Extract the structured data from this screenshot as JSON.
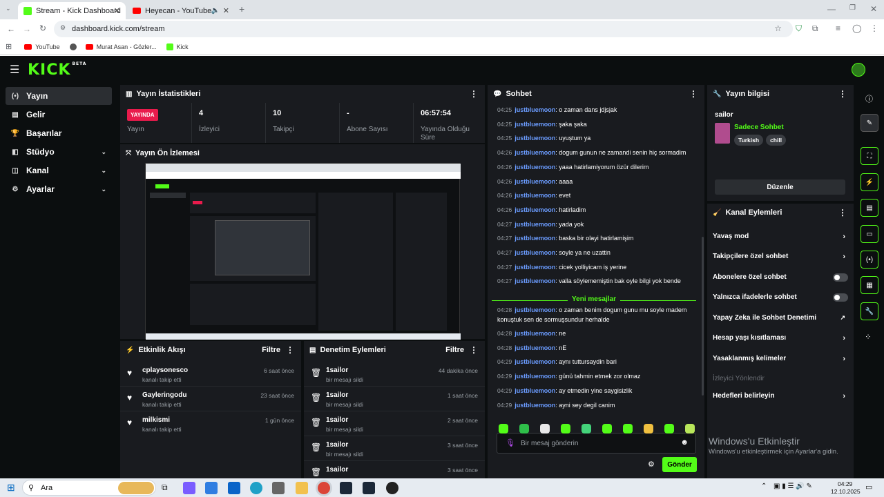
{
  "browser": {
    "tabs": [
      {
        "title": "Stream - Kick Dashboard",
        "active": true
      },
      {
        "title": "Heyecan - YouTube",
        "active": false
      }
    ],
    "url": "dashboard.kick.com/stream",
    "bookmarks": [
      "YouTube",
      "Murat Asan - Gözler...",
      "Kick"
    ]
  },
  "colors": {
    "accent": "#53fc18",
    "live": "#e91b4c",
    "username": "#6b9cff"
  },
  "logo": {
    "text": "KICK",
    "badge": "BETA"
  },
  "nav": [
    {
      "label": "Yayın",
      "icon": "stream-icon",
      "chevron": false,
      "active": true
    },
    {
      "label": "Gelir",
      "icon": "wallet-icon",
      "chevron": false
    },
    {
      "label": "Başarılar",
      "icon": "trophy-icon",
      "chevron": false
    },
    {
      "label": "Stüdyo",
      "icon": "studio-icon",
      "chevron": true
    },
    {
      "label": "Kanal",
      "icon": "channel-icon",
      "chevron": true
    },
    {
      "label": "Ayarlar",
      "icon": "gear-icon",
      "chevron": true
    }
  ],
  "stats": {
    "title": "Yayın İstatistikleri",
    "items": [
      {
        "value": "YAYINDA",
        "label": "Yayın"
      },
      {
        "value": "4",
        "label": "İzleyici"
      },
      {
        "value": "10",
        "label": "Takipçi"
      },
      {
        "value": "-",
        "label": "Abone Sayısı"
      },
      {
        "value": "06:57:54",
        "label": "Yayında Olduğu Süre"
      }
    ]
  },
  "preview": {
    "title": "Yayın Ön İzlemesi"
  },
  "activity": {
    "title": "Etkinlik Akışı",
    "filter": "Filtre",
    "items": [
      {
        "name": "cplaysonesco",
        "sub": "kanalı takip etti",
        "time": "6 saat önce"
      },
      {
        "name": "Gayleringodu",
        "sub": "kanalı takip etti",
        "time": "23 saat önce"
      },
      {
        "name": "milkismi",
        "sub": "kanalı takip etti",
        "time": "1 gün önce"
      }
    ]
  },
  "moderation": {
    "title": "Denetim Eylemleri",
    "filter": "Filtre",
    "items": [
      {
        "name": "1sailor",
        "sub": "bir mesajı sildi",
        "time": "44 dakika önce"
      },
      {
        "name": "1sailor",
        "sub": "bir mesajı sildi",
        "time": "1 saat önce"
      },
      {
        "name": "1sailor",
        "sub": "bir mesajı sildi",
        "time": "2 saat önce"
      },
      {
        "name": "1sailor",
        "sub": "bir mesajı sildi",
        "time": "3 saat önce"
      },
      {
        "name": "1sailor",
        "sub": "",
        "time": "3 saat önce"
      }
    ]
  },
  "chat": {
    "title": "Sohbet",
    "messages_top": [
      {
        "time": "04:25",
        "user": "justbluemoon",
        "text": ": o zaman dans jdjsjak"
      },
      {
        "time": "04:25",
        "user": "justbluemoon",
        "text": ": şaka şaka"
      },
      {
        "time": "04:25",
        "user": "justbluemoon",
        "text": ": uyuştum ya"
      },
      {
        "time": "04:26",
        "user": "justbluemoon",
        "text": ": dogum gunun ne zamandi senin hiç sormadim"
      },
      {
        "time": "04:26",
        "user": "justbluemoon",
        "text": ": yaaa hatirlamiyorum özür dilerim"
      },
      {
        "time": "04:26",
        "user": "justbluemoon",
        "text": ": aaaa"
      },
      {
        "time": "04:26",
        "user": "justbluemoon",
        "text": ": evet"
      },
      {
        "time": "04:26",
        "user": "justbluemoon",
        "text": ": hatirladim"
      },
      {
        "time": "04:27",
        "user": "justbluemoon",
        "text": ": yada yok"
      },
      {
        "time": "04:27",
        "user": "justbluemoon",
        "text": ": baska bir olayi hatirlamişim"
      },
      {
        "time": "04:27",
        "user": "justbluemoon",
        "text": ": soyle ya ne uzattin"
      },
      {
        "time": "04:27",
        "user": "justbluemoon",
        "text": ": cicek yolliyicam iş yerine"
      },
      {
        "time": "04:27",
        "user": "justbluemoon",
        "text": ": valla söylememiştin bak oyle bilgi yok bende"
      }
    ],
    "new_messages": "Yeni mesajlar",
    "messages_bottom": [
      {
        "time": "04:28",
        "user": "justbluemoon",
        "text": ": o zaman benim dogum gunu mu soyle madem konuştuk sen de sormuşsundur herhalde"
      },
      {
        "time": "04:28",
        "user": "justbluemoon",
        "text": ": ne"
      },
      {
        "time": "04:28",
        "user": "justbluemoon",
        "text": ": nE"
      },
      {
        "time": "04:29",
        "user": "justbluemoon",
        "text": ": aynı tuttursaydin bari"
      },
      {
        "time": "04:29",
        "user": "justbluemoon",
        "text": ": günü tahmin etmek zor olmaz"
      },
      {
        "time": "04:29",
        "user": "justbluemoon",
        "text": ": ay etmedin yine saygisizlik"
      },
      {
        "time": "04:29",
        "user": "justbluemoon",
        "text": ": ayni sey degil canim"
      }
    ],
    "input_placeholder": "Bir mesaj gönderin",
    "send": "Gönder"
  },
  "stream_info": {
    "title": "Yayın bilgisi",
    "streamer": "sailor",
    "stream_title": "Sadece Sohbet",
    "tags": [
      "Turkish",
      "chill"
    ],
    "edit": "Düzenle"
  },
  "channel_actions": {
    "title": "Kanal Eylemleri",
    "items": [
      {
        "label": "Yavaş mod",
        "control": "arrow"
      },
      {
        "label": "Takipçilere özel sohbet",
        "control": "arrow"
      },
      {
        "label": "Abonelere özel sohbet",
        "control": "toggle"
      },
      {
        "label": "Yalnızca ifadelerle sohbet",
        "control": "toggle"
      },
      {
        "label": "Yapay Zeka ile Sohbet Denetimi",
        "control": "external"
      },
      {
        "label": "Hesap yaşı kısıtlaması",
        "control": "arrow"
      },
      {
        "label": "Yasaklanmış kelimeler",
        "control": "arrow"
      },
      {
        "label": "İzleyici Yönlendir",
        "control": "none",
        "disabled": true
      },
      {
        "label": "Hedefleri belirleyin",
        "control": "arrow"
      }
    ]
  },
  "watermark": {
    "title": "Windows'u Etkinleştir",
    "sub": "Windows'u etkinleştirmek için Ayarlar'a gidin."
  },
  "taskbar": {
    "search": "Ara",
    "time": "04:29",
    "date": "12.10.2025"
  }
}
